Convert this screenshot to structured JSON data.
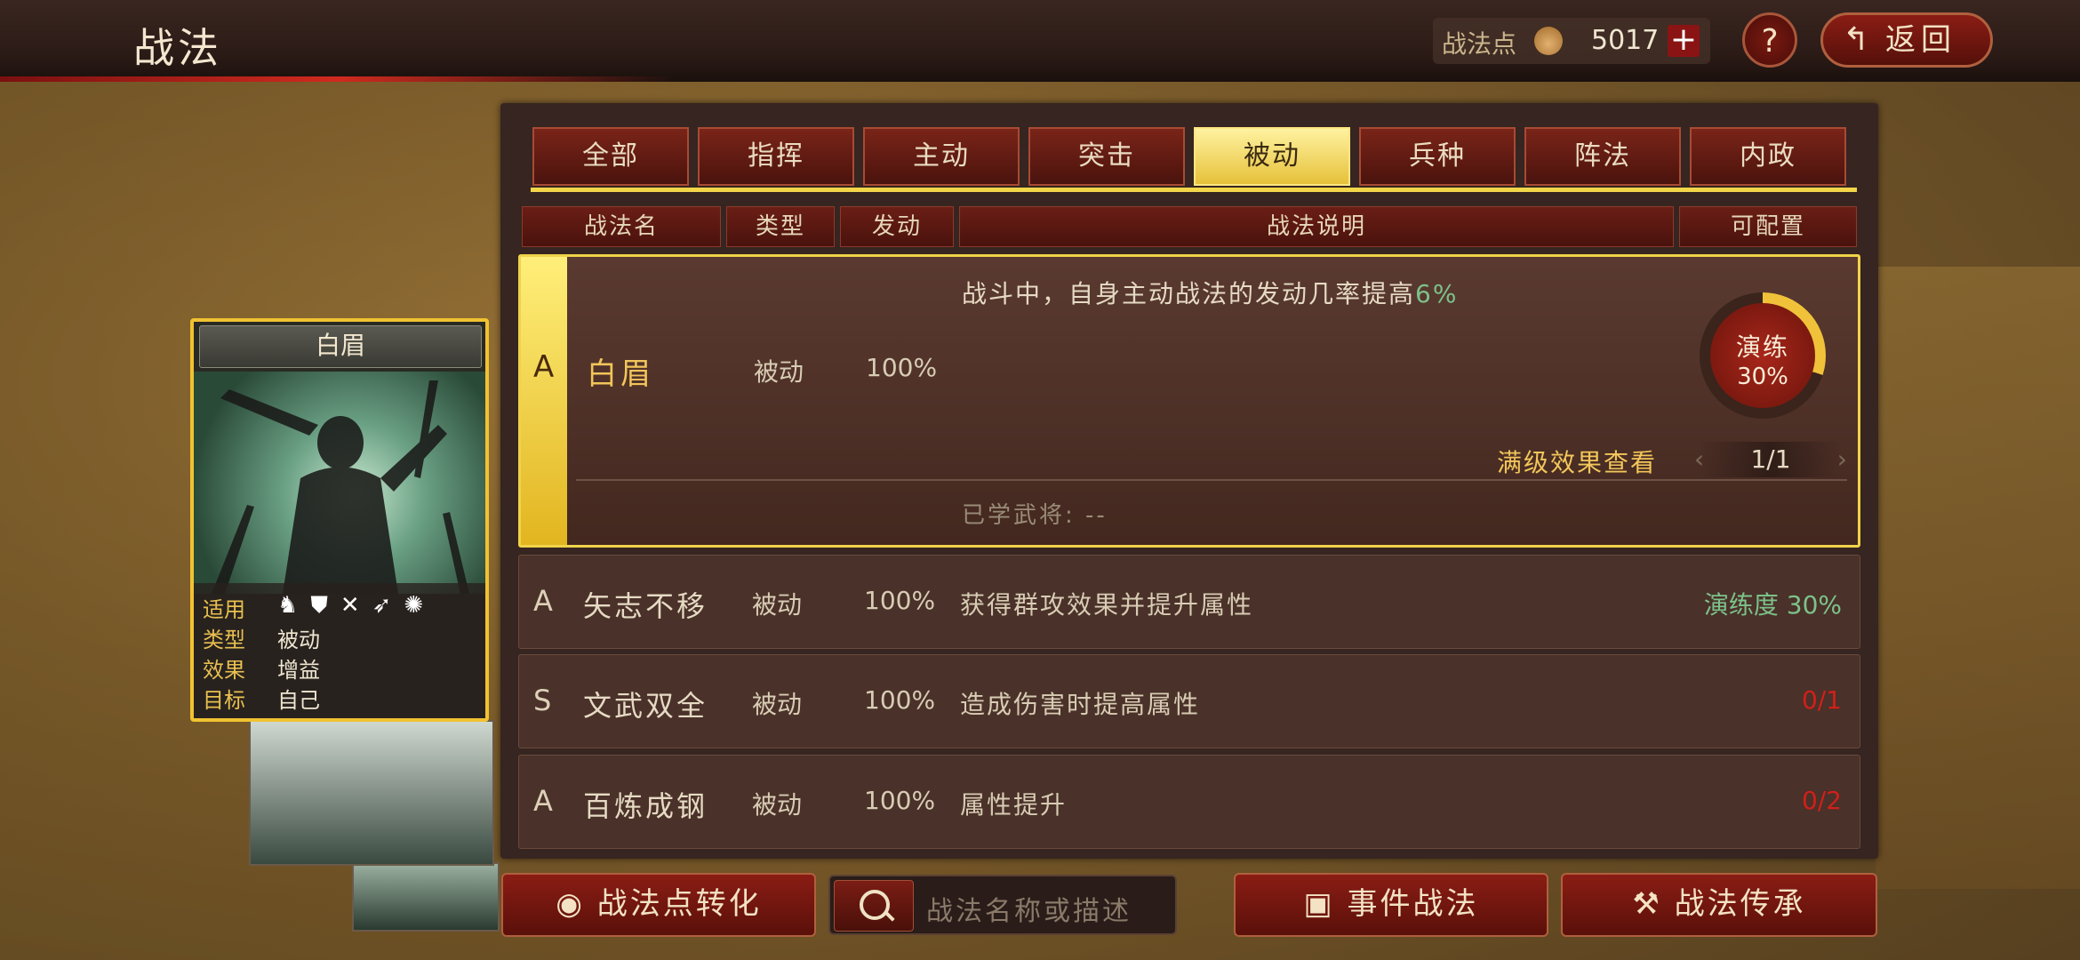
{
  "header": {
    "title": "战法",
    "points_label": "战法点",
    "points_value": "5017",
    "plus_label": "+",
    "help_label": "?",
    "back_label": "返回",
    "back_icon": "↰"
  },
  "tabs": [
    {
      "label": "全部",
      "active": false
    },
    {
      "label": "指挥",
      "active": false
    },
    {
      "label": "主动",
      "active": false
    },
    {
      "label": "突击",
      "active": false
    },
    {
      "label": "被动",
      "active": true
    },
    {
      "label": "兵种",
      "active": false
    },
    {
      "label": "阵法",
      "active": false
    },
    {
      "label": "内政",
      "active": false
    }
  ],
  "columns": [
    "战法名",
    "类型",
    "发动",
    "战法说明",
    "可配置"
  ],
  "selected_skill": {
    "grade": "A",
    "name": "白眉",
    "type": "被动",
    "rate": "100%",
    "desc_main": "战斗中，自身主动战法的发动几率提高",
    "desc_highlight": "6%",
    "train_label": "演练",
    "train_pct": "30%",
    "full_effect_label": "满级效果查看",
    "pager": "1/1",
    "learned_label": "已学武将:",
    "learned_value": "--"
  },
  "skills": [
    {
      "grade": "A",
      "name": "矢志不移",
      "type": "被动",
      "rate": "100%",
      "desc": "获得群攻效果并提升属性",
      "status": "演练度 30%",
      "status_color": "#7cc28a"
    },
    {
      "grade": "S",
      "name": "文武双全",
      "type": "被动",
      "rate": "100%",
      "desc": "造成伤害时提高属性",
      "status": "0/1",
      "status_color": "#d0201a"
    },
    {
      "grade": "A",
      "name": "百炼成钢",
      "type": "被动",
      "rate": "100%",
      "desc": "属性提升",
      "status": "0/2",
      "status_color": "#d0201a"
    }
  ],
  "card": {
    "title": "白眉",
    "applicable_label": "适用",
    "applicable_icons": [
      "cavalry-icon",
      "shield-icon",
      "bow-icon",
      "spear-icon",
      "wheel-icon"
    ],
    "type_label": "类型",
    "type_value": "被动",
    "effect_label": "效果",
    "effect_value": "增益",
    "target_label": "目标",
    "target_value": "自己"
  },
  "bottom": {
    "convert_label": "战法点转化",
    "search_placeholder": "战法名称或描述",
    "event_label": "事件战法",
    "inherit_label": "战法传承"
  },
  "colors": {
    "accent_gold": "#f0d24a",
    "button_red": "#8a1d14",
    "highlight_green": "#7cc28a",
    "warn_red": "#d0201a"
  }
}
